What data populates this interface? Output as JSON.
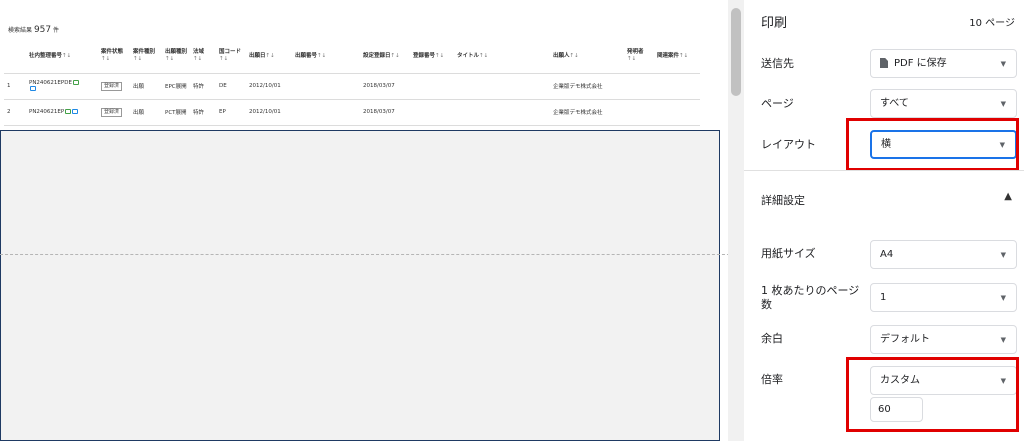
{
  "preview": {
    "result_label": "検索結果",
    "result_count": "957",
    "result_unit": "件",
    "sort_icon": "↑↓",
    "columns": [
      "社内整理番号",
      "案件状態",
      "案件種別",
      "出願種別",
      "法域",
      "国コード",
      "出願日",
      "出願番号",
      "設定登録日",
      "登録番号",
      "タイトル",
      "出願人",
      "発明者",
      "関連案件"
    ],
    "rows": [
      [
        "1",
        "PN240621EPDE",
        "登録済",
        "出願",
        "EPC展開",
        "特許",
        "DE",
        "2012/10/01",
        "",
        "2018/03/07",
        "",
        "",
        "企業版デモ株式会社",
        "",
        ""
      ],
      [
        "2",
        "PN240621EP",
        "登録済",
        "出願",
        "PCT展開",
        "特許",
        "EP",
        "2012/10/01",
        "",
        "2018/03/07",
        "",
        "",
        "企業版デモ株式会社",
        "",
        ""
      ]
    ]
  },
  "panel": {
    "title": "印刷",
    "pages_info": "10 ページ",
    "destination": {
      "label": "送信先",
      "value": "PDF に保存"
    },
    "pages": {
      "label": "ページ",
      "value": "すべて"
    },
    "layout": {
      "label": "レイアウト",
      "value": "横"
    },
    "advanced": {
      "label": "詳細設定"
    },
    "paper_size": {
      "label": "用紙サイズ",
      "value": "A4"
    },
    "pages_per_sheet": {
      "label": "1 枚あたりのページ数",
      "value": "1"
    },
    "margins": {
      "label": "余白",
      "value": "デフォルト"
    },
    "scale": {
      "label": "倍率",
      "value": "カスタム",
      "custom_value": "60"
    }
  },
  "colors": {
    "highlight": "#e00000",
    "focus": "#1a73e8",
    "frame": "#1f3a63"
  }
}
